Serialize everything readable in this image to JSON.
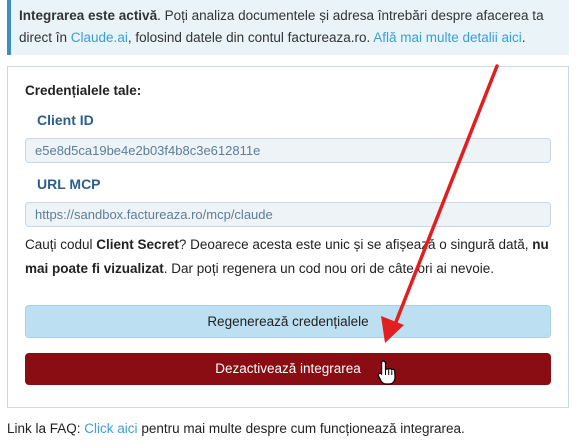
{
  "intro": {
    "status_bold": "Integrarea este activă",
    "text1": ". Poți analiza documentele și adresa întrebări despre afacerea ta direct în ",
    "claude_link": "Claude.ai",
    "text2": ", folosind datele din contul factureaza.ro. ",
    "details_link": "Află mai multe detalii aici",
    "text3": "."
  },
  "credentials": {
    "title": "Credențialele tale:",
    "client_id_label": "Client ID",
    "client_id_value": "e5e8d5ca19be4e2b03f4b8c3e612811e",
    "mcp_url_label": "URL MCP",
    "mcp_url_value": "https://sandbox.factureaza.ro/mcp/claude"
  },
  "notice": {
    "t1": "Cauți codul ",
    "b1": "Client Secret",
    "t2": "? Deoarece acesta este unic și se afișează o singură dată, ",
    "b2": "nu mai poate fi vizualizat",
    "t3": ". Dar poți regenera un cod nou ori de câte ori ai nevoie."
  },
  "buttons": {
    "regenerate": "Regenerează credențialele",
    "deactivate": "Dezactivează integrarea"
  },
  "faq": {
    "t1": "Link la FAQ: ",
    "link": "Click aici",
    "t2": " pentru mai multe despre cum funcționează integrarea."
  },
  "colors": {
    "deactivate_bg": "#8b0d14",
    "regenerate_bg": "#bcdff1",
    "annotation_arrow": "#e02020"
  },
  "icons": {
    "cursor": "hand-pointer-icon",
    "annotation": "red-arrow"
  }
}
